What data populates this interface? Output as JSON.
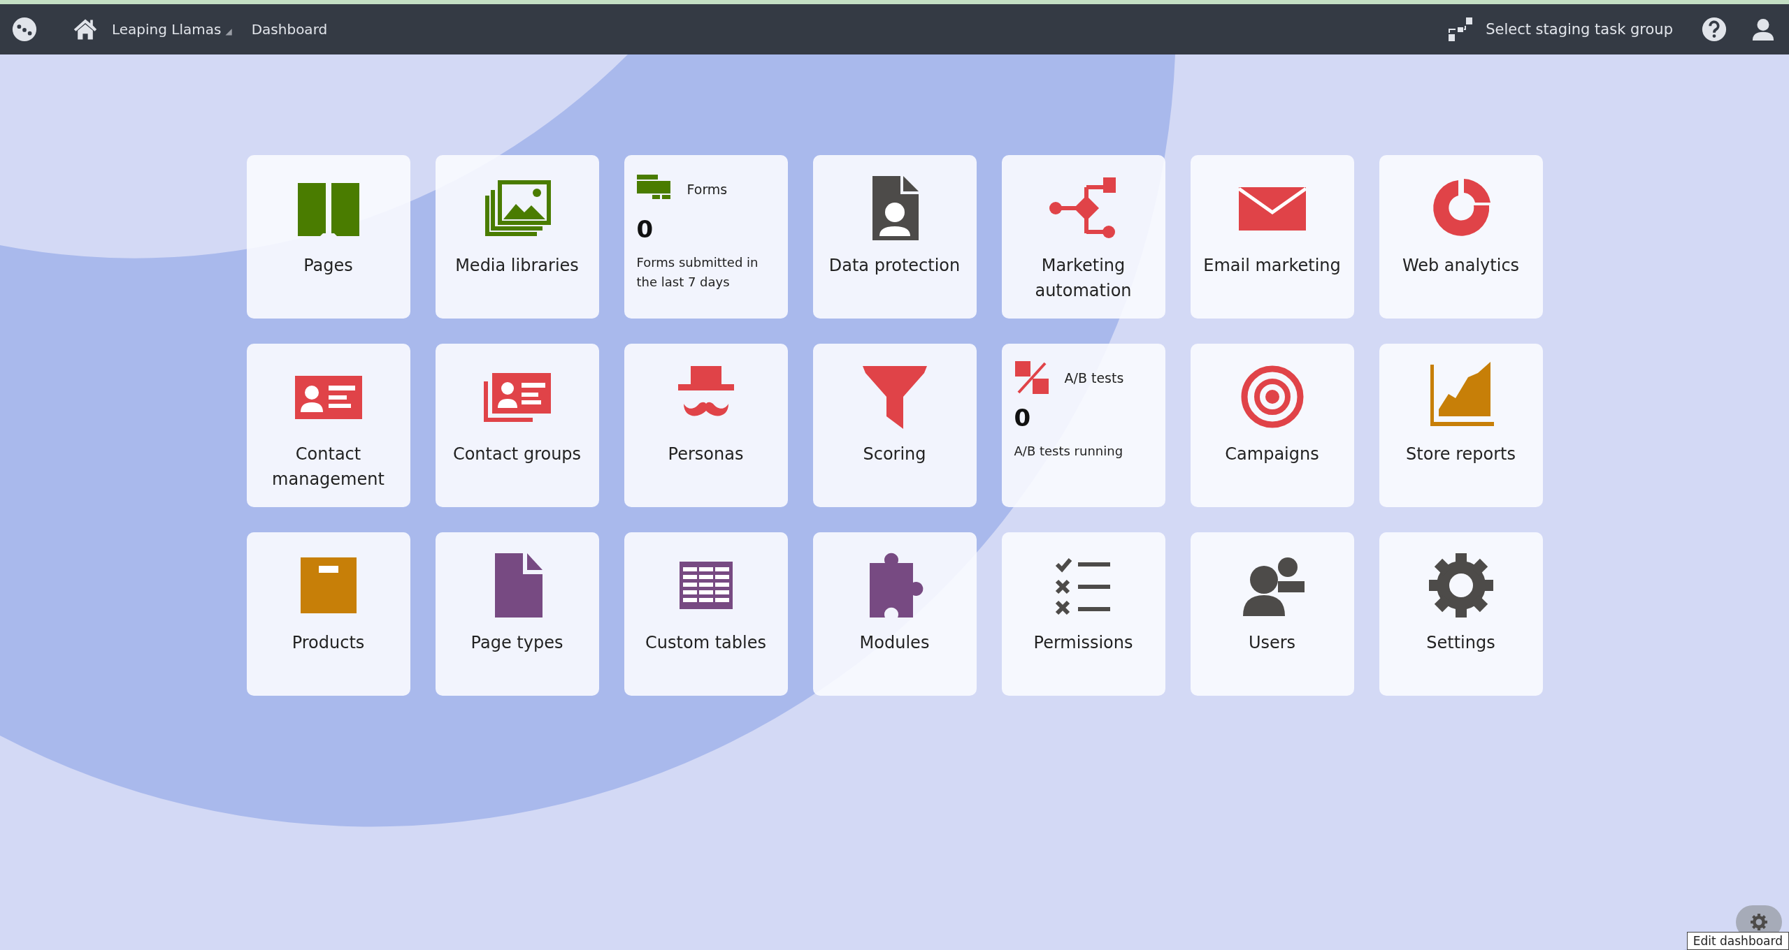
{
  "app_bar": {
    "site": "Leaping Llamas",
    "site_caret": "◢",
    "breadcrumb": "Dashboard",
    "staging": "Select staging task group"
  },
  "tiles": [
    {
      "kind": "app",
      "label": "Pages"
    },
    {
      "kind": "app",
      "label": "Media libraries"
    },
    {
      "kind": "stat",
      "title": "Forms",
      "value": "0",
      "description": "Forms submitted in the last 7 days"
    },
    {
      "kind": "app",
      "label": "Data protection"
    },
    {
      "kind": "app",
      "label": "Marketing automation"
    },
    {
      "kind": "app",
      "label": "Email marketing"
    },
    {
      "kind": "app",
      "label": "Web analytics"
    },
    {
      "kind": "app",
      "label": "Contact management"
    },
    {
      "kind": "app",
      "label": "Contact groups"
    },
    {
      "kind": "app",
      "label": "Personas"
    },
    {
      "kind": "app",
      "label": "Scoring"
    },
    {
      "kind": "stat",
      "title": "A/B tests",
      "value": "0",
      "description": "A/B tests running"
    },
    {
      "kind": "app",
      "label": "Campaigns"
    },
    {
      "kind": "app",
      "label": "Store reports"
    },
    {
      "kind": "app",
      "label": "Products"
    },
    {
      "kind": "app",
      "label": "Page types"
    },
    {
      "kind": "app",
      "label": "Custom tables"
    },
    {
      "kind": "app",
      "label": "Modules"
    },
    {
      "kind": "app",
      "label": "Permissions"
    },
    {
      "kind": "app",
      "label": "Users"
    },
    {
      "kind": "app",
      "label": "Settings"
    }
  ],
  "edit_button": {
    "tooltip": "Edit dashboard"
  }
}
